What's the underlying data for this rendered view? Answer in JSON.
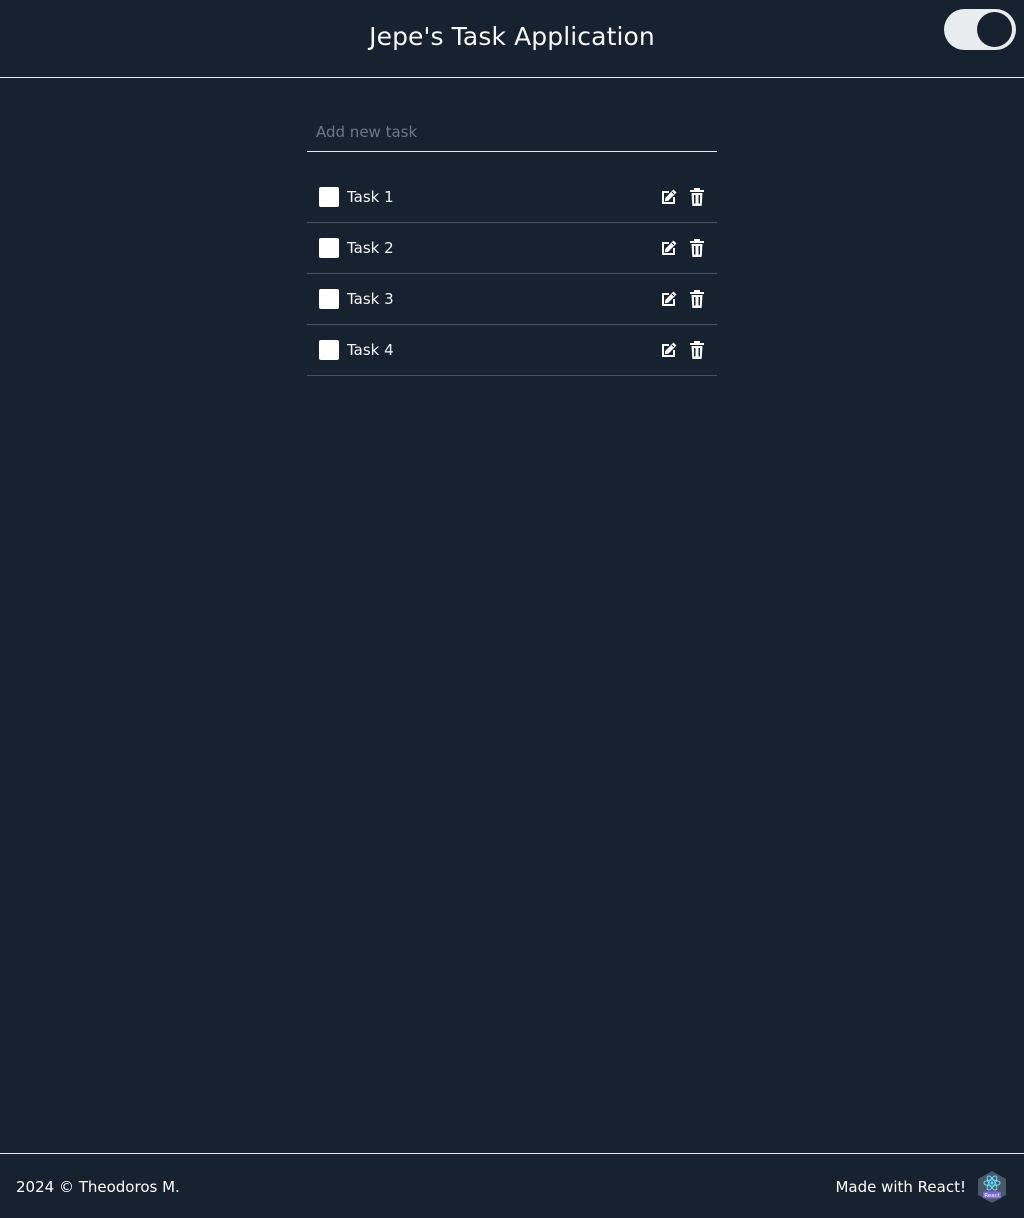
{
  "header": {
    "title": "Jepe's Task Application",
    "theme_toggle": {
      "state": "on"
    }
  },
  "task_input": {
    "value": "",
    "placeholder": "Add new task"
  },
  "tasks": [
    {
      "label": "Task 1",
      "checked": false,
      "edit_icon": "edit-icon",
      "delete_icon": "trash-icon"
    },
    {
      "label": "Task 2",
      "checked": false,
      "edit_icon": "edit-icon",
      "delete_icon": "trash-icon"
    },
    {
      "label": "Task 3",
      "checked": false,
      "edit_icon": "edit-icon",
      "delete_icon": "trash-icon"
    },
    {
      "label": "Task 4",
      "checked": false,
      "edit_icon": "edit-icon",
      "delete_icon": "trash-icon"
    }
  ],
  "footer": {
    "copyright": "2024 © Theodoros M.",
    "made_with": "Made with React!",
    "logo_icon": "react-logo-icon",
    "logo_text": "React"
  },
  "colors": {
    "background": "#172230",
    "text": "#ffffff",
    "divider": "#e6e9ee",
    "row_divider": "#4a5462",
    "react_accent": "#61dafb"
  }
}
